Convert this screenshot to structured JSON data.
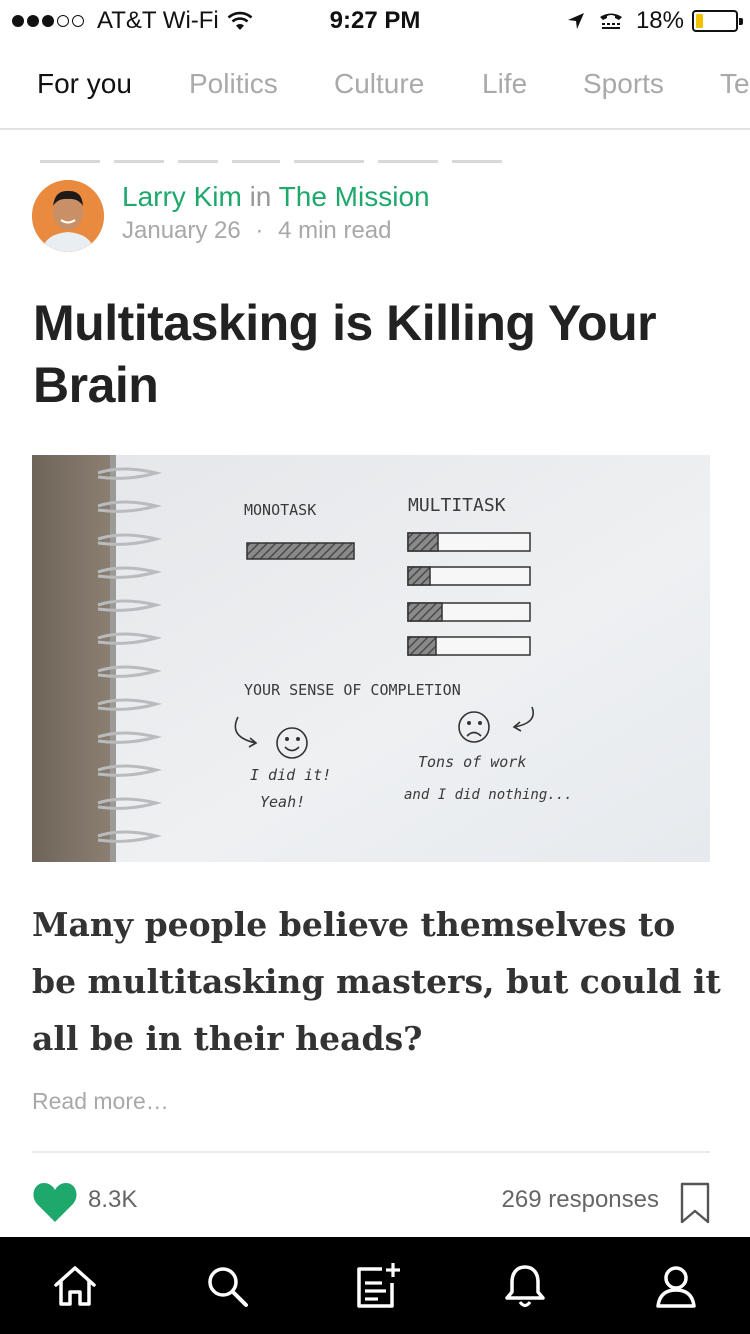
{
  "status_bar": {
    "carrier": "AT&T Wi-Fi",
    "time": "9:27 PM",
    "battery_percent": "18%",
    "battery_level": 0.18,
    "signal_bars": 3,
    "icons": [
      "wifi-icon",
      "location-arrow-icon",
      "tty-icon",
      "battery-icon"
    ]
  },
  "tabs": [
    {
      "label": "For you",
      "active": true
    },
    {
      "label": "Politics",
      "active": false
    },
    {
      "label": "Culture",
      "active": false
    },
    {
      "label": "Life",
      "active": false
    },
    {
      "label": "Sports",
      "active": false
    },
    {
      "label": "Te",
      "active": false
    }
  ],
  "article": {
    "author": "Larry Kim",
    "in_word": "in",
    "publication": "The Mission",
    "date": "January 26",
    "separator": "·",
    "read_time": "4 min read",
    "title": "Multitasking is Killing Your Brain",
    "image": {
      "monotask_label": "MONOTASK",
      "multitask_label": "MULTITASK",
      "completion_label": "YOUR SENSE OF COMPLETION",
      "left_note_1": "I did it!",
      "left_note_2": "Yeah!",
      "right_note_1": "Tons of work",
      "right_note_2": "and I did nothing..."
    },
    "subtitle": "Many people believe themselves to be multitasking masters, but could it all be in their heads?",
    "read_more": "Read more…",
    "likes": "8.3K",
    "responses": "269 responses"
  },
  "colors": {
    "accent_green": "#1ea86b",
    "inactive_tab": "#a9a9a9",
    "nav_background": "#000000",
    "battery_yellow": "#f2c200"
  },
  "bottom_nav": [
    {
      "name": "home-icon"
    },
    {
      "name": "search-icon"
    },
    {
      "name": "write-story-icon"
    },
    {
      "name": "notifications-bell-icon"
    },
    {
      "name": "profile-icon"
    }
  ]
}
